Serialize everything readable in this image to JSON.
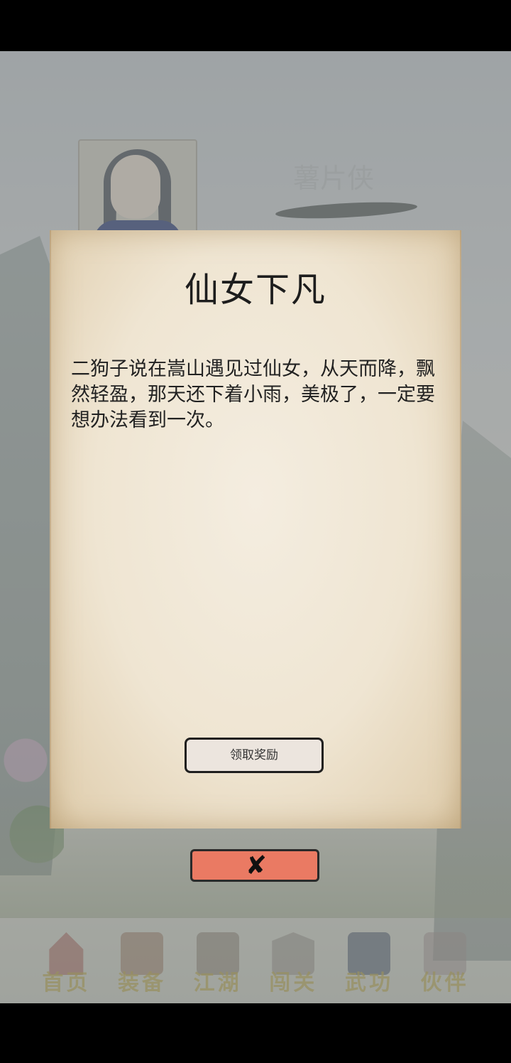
{
  "header": {
    "player_name": "薯片侠"
  },
  "dialog": {
    "title": "仙女下凡",
    "body": "二狗子说在嵩山遇见过仙女，从天而降，飘然轻盈，那天还下着小雨，美极了，一定要想办法看到一次。",
    "claim_label": "领取奖励",
    "close_glyph": "✘"
  },
  "bottom_nav": {
    "items": [
      {
        "label": "首页",
        "icon": "home-icon"
      },
      {
        "label": "装备",
        "icon": "armor-icon"
      },
      {
        "label": "江湖",
        "icon": "scroll-icon"
      },
      {
        "label": "闯关",
        "icon": "swords-icon"
      },
      {
        "label": "武功",
        "icon": "book-icon"
      },
      {
        "label": "伙伴",
        "icon": "partners-icon"
      }
    ]
  },
  "colors": {
    "close_button": "#ea7a63",
    "paper": "#efe5d2",
    "nav_label": "#b2a04a"
  }
}
